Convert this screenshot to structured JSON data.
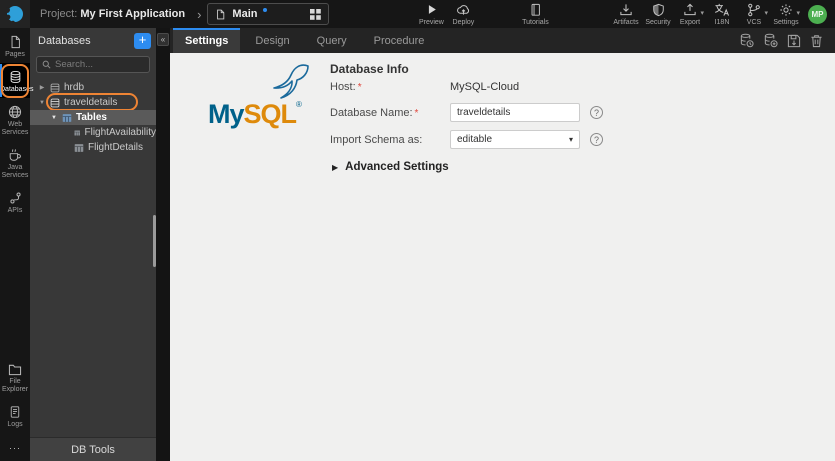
{
  "topbar": {
    "project_label": "Project:",
    "project_name": "My First Application",
    "main_tab_label": "Main",
    "preview_label": "Preview",
    "deploy_label": "Deploy",
    "tutorials_label": "Tutorials",
    "artifacts_label": "Artifacts",
    "security_label": "Security",
    "export_label": "Export",
    "i18n_label": "I18N",
    "vcs_label": "VCS",
    "settings_label": "Settings",
    "avatar_initials": "MP"
  },
  "sidebar": {
    "pages_label": "Pages",
    "databases_label": "Databases",
    "web_services_label": "Web Services",
    "java_services_label": "Java Services",
    "apis_label": "APIs",
    "file_explorer_label": "File Explorer",
    "logs_label": "Logs"
  },
  "db_panel": {
    "title": "Databases",
    "search_placeholder": "Search...",
    "tree": {
      "hrdb": "hrdb",
      "traveldetails": "traveldetails",
      "tables": "Tables",
      "flight_availability": "FlightAvailability",
      "flight_details": "FlightDetails"
    },
    "db_tools_label": "DB Tools"
  },
  "workspace": {
    "tabs": {
      "settings": "Settings",
      "design": "Design",
      "query": "Query",
      "procedure": "Procedure"
    }
  },
  "form": {
    "section_title": "Database Info",
    "host_label": "Host:",
    "host_value": "MySQL-Cloud",
    "db_name_label": "Database Name:",
    "db_name_value": "traveldetails",
    "import_schema_label": "Import Schema as:",
    "import_schema_value": "editable",
    "advanced_settings_label": "Advanced Settings",
    "required_marker": "*",
    "help_glyph": "?"
  },
  "logo": {
    "my": "My",
    "sql": "SQL",
    "registered": "®"
  },
  "icons": {
    "add": "+",
    "collapse": "«",
    "breadcrumb_chevron": "›",
    "caret_down": "▾",
    "tree_expanded": "▼",
    "tree_collapsed": "▶",
    "advanced_caret": "▶",
    "more": "···"
  },
  "colors": {
    "accent_blue": "#2d8cf0",
    "annotation_orange": "#ee8434",
    "avatar_green": "#4caf50",
    "mysql_blue": "#00618a",
    "mysql_orange": "#de8a0b"
  }
}
